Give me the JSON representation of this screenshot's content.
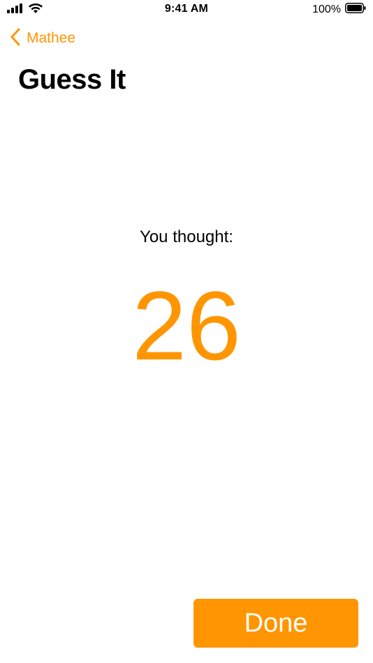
{
  "status_bar": {
    "time": "9:41 AM",
    "battery": "100%",
    "icons": [
      "cellular-signal-icon",
      "wifi-icon",
      "battery-icon"
    ]
  },
  "nav": {
    "back_label": "Mathee",
    "title": "Guess It"
  },
  "content": {
    "prompt": "You thought:",
    "number": "26"
  },
  "actions": {
    "done_label": "Done"
  },
  "colors": {
    "accent": "#ff9500",
    "text": "#000000",
    "background": "#ffffff"
  }
}
